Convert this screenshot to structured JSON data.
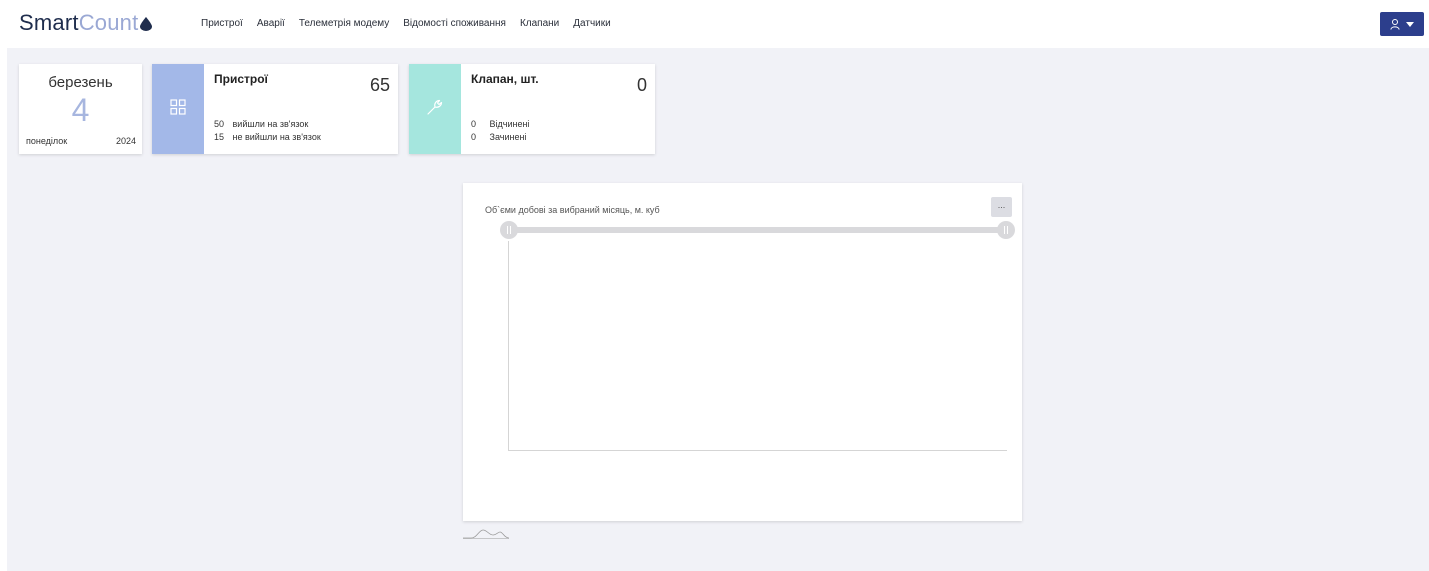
{
  "app": {
    "logo_part1": "Smart",
    "logo_part2": "Count"
  },
  "nav": {
    "items": [
      {
        "label": "Пристрої"
      },
      {
        "label": "Аварії"
      },
      {
        "label": "Телеметрія модему"
      },
      {
        "label": "Відомості споживання"
      },
      {
        "label": "Клапани"
      },
      {
        "label": "Датчики"
      }
    ]
  },
  "user_menu": {
    "icon": "user-icon",
    "color": "#2c3e8c"
  },
  "date_card": {
    "month": "березень",
    "day": "4",
    "weekday": "понеділок",
    "year": "2024"
  },
  "devices_card": {
    "title": "Пристрої",
    "total": "65",
    "online_count": "50",
    "online_label": "вийшли на зв'язок",
    "offline_count": "15",
    "offline_label": "не вийшли на зв'язок",
    "icon": "grid-icon",
    "accent": "#a3b8e8"
  },
  "valves_card": {
    "title": "Клапан, шт.",
    "total": "0",
    "open_count": "0",
    "open_label": "Відчинені",
    "closed_count": "0",
    "closed_label": "Зачинені",
    "icon": "wrench-icon",
    "accent": "#a5e6de"
  },
  "chart_panel": {
    "title": "Об`єми добові за вибраний місяць, м. куб",
    "menu_label": "..."
  },
  "chart_data": {
    "type": "line",
    "title": "Об`єми добові за вибраний місяць, м. куб",
    "series": [],
    "x": [],
    "grid": false,
    "range_slider": true
  }
}
